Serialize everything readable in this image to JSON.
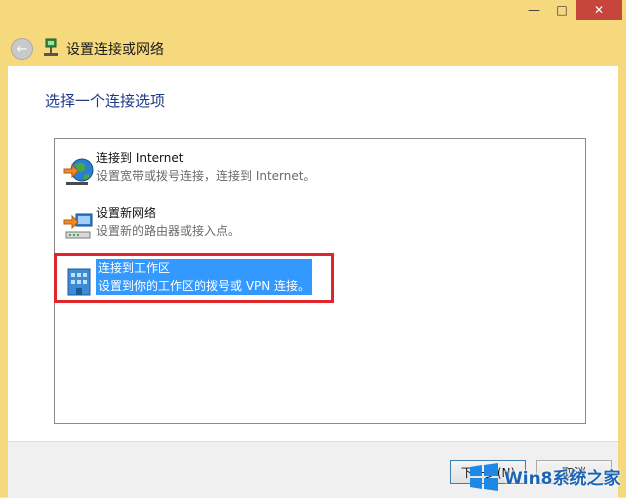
{
  "window": {
    "minimize_glyph": "—",
    "maximize_glyph": "□",
    "close_glyph": "✕"
  },
  "navbar": {
    "back_glyph": "←",
    "title": "设置连接或网络"
  },
  "main": {
    "heading": "选择一个连接选项",
    "options": [
      {
        "title": "连接到 Internet",
        "description": "设置宽带或拨号连接，连接到 Internet。",
        "icon": "internet-globe-icon",
        "selected": false
      },
      {
        "title": "设置新网络",
        "description": "设置新的路由器或接入点。",
        "icon": "network-router-icon",
        "selected": false
      },
      {
        "title": "连接到工作区",
        "description": "设置到你的工作区的拨号或 VPN 连接。",
        "icon": "workplace-building-icon",
        "selected": true
      }
    ]
  },
  "footer": {
    "next_label": "下一步(N)",
    "cancel_label": "取消"
  },
  "watermark": {
    "text": "Win8系统之家"
  },
  "colors": {
    "frame": "#f5d97c",
    "selection": "#3399ff",
    "highlight_border": "#e1262b",
    "heading": "#1e3a8a"
  }
}
